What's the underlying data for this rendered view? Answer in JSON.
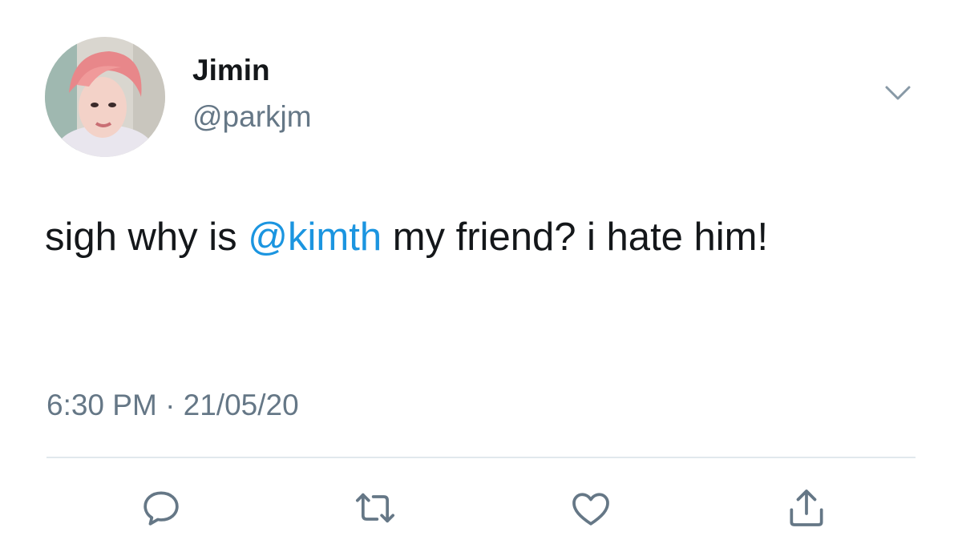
{
  "user": {
    "display_name": "Jimin",
    "handle": "@parkjm"
  },
  "tweet": {
    "text_before": "sigh why is ",
    "mention": "@kimth",
    "text_after": " my friend? i hate him!",
    "timestamp": "6:30 PM · 21/05/20"
  },
  "actions": [
    "reply-icon",
    "retweet-icon",
    "like-icon",
    "share-icon"
  ],
  "colors": {
    "mention": "#1b95e0",
    "secondary_text": "#657786",
    "primary_text": "#14171a",
    "divider": "#e1e8ed"
  }
}
